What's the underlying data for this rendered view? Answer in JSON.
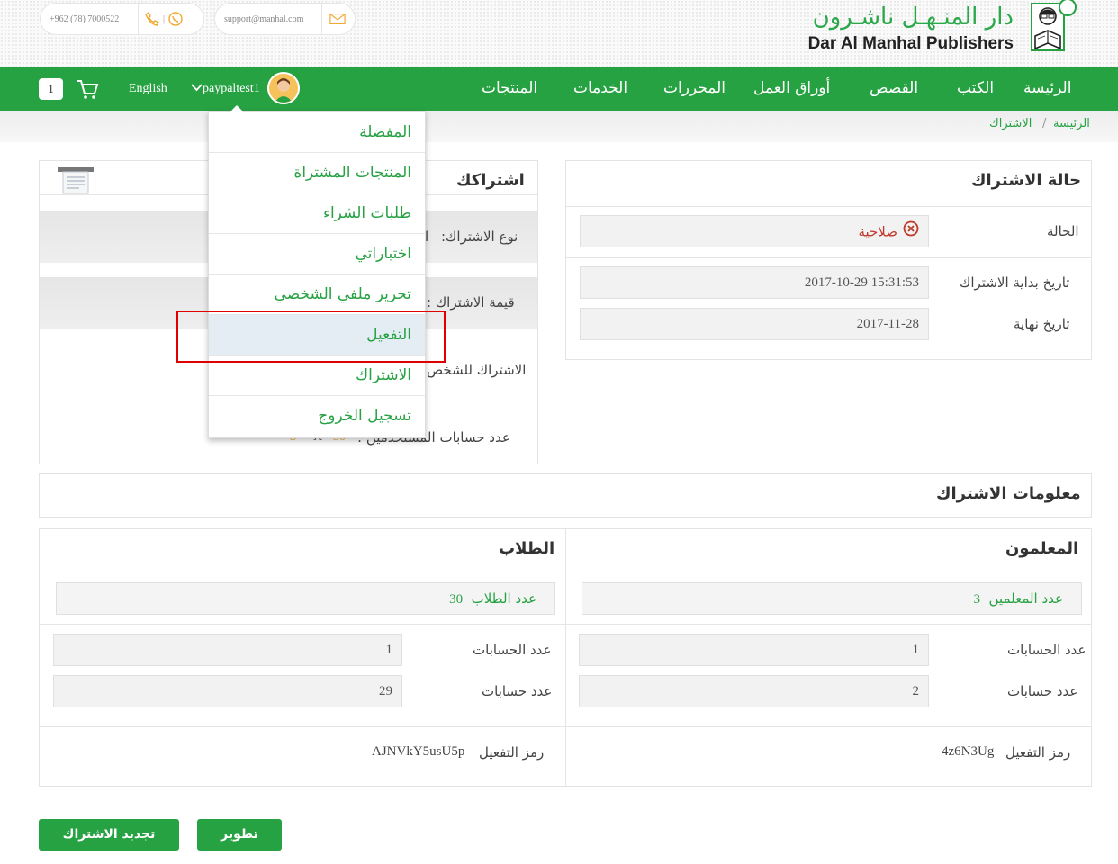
{
  "topbar": {
    "phone": "+962 (78) 7000522",
    "email": "support@manhal.com"
  },
  "logo": {
    "arabic": "دار المنـهـل ناشـرون",
    "english": "Dar Al Manhal Publishers"
  },
  "nav": {
    "items": [
      "الرئيسة",
      "الكتب",
      "القصص",
      "أوراق العمل",
      "المحررات",
      "الخدمات",
      "المنتجات"
    ],
    "language": "English",
    "username": "paypaltest1",
    "cart_count": "1"
  },
  "breadcrumb": {
    "home": "الرئيسة",
    "separator": "/",
    "current": "الاشتراك"
  },
  "status_panel": {
    "title": "حالة الاشتراك",
    "status_label": "الحالة",
    "status_value": "صلاحية",
    "start_label": "تاريخ بداية الاشتراك",
    "start_value": "2017-10-29 15:31:53",
    "end_label": "تاريخ نهاية",
    "end_value": "2017-11-28"
  },
  "subscription_panel": {
    "title": "اشتراكك",
    "type_label": "نوع الاشتراك:",
    "type_value_fragment": "ا",
    "price_label": "قيمة الاشتراك :",
    "personal_label": "الاشتراك للشخص",
    "users_label": "عدد حسابات المستخدمين :",
    "users_value_fragment": "30",
    "users_suffix_fragment": "X",
    "users_prefix_fragment": "$"
  },
  "dropdown_menu": {
    "items": [
      "المفضلة",
      "المنتجات المشتراة",
      "طلبات الشراء",
      "اختباراتي",
      "تحرير ملفي الشخصي",
      "التفعيل",
      "الاشتراك",
      "تسجيل الخروج"
    ],
    "active_index": 5
  },
  "info_panel": {
    "title": "معلومات الاشتراك",
    "teachers": {
      "header": "المعلمون",
      "count_label": "عدد المعلمين",
      "count_value": "3",
      "accounts_label": "عدد الحسابات",
      "accounts_value": "1",
      "accounts2_label": "عدد حسابات",
      "accounts2_value": "2",
      "code_label": "رمز التفعيل",
      "code_value": "4z6N3Ug"
    },
    "students": {
      "header": "الطلاب",
      "count_label": "عدد الطلاب",
      "count_value": "30",
      "accounts_label": "عدد الحسابات",
      "accounts_value": "1",
      "accounts2_label": "عدد حسابات",
      "accounts2_value": "29",
      "code_label": "رمز التفعيل",
      "code_value": "AJNVkY5usU5p"
    }
  },
  "actions": {
    "upgrade": "تطوير",
    "renew": "تجديد الاشتراك"
  },
  "colors": {
    "brand_green": "#27a243",
    "error_red": "#c0392b",
    "highlight_red": "#e00000"
  }
}
